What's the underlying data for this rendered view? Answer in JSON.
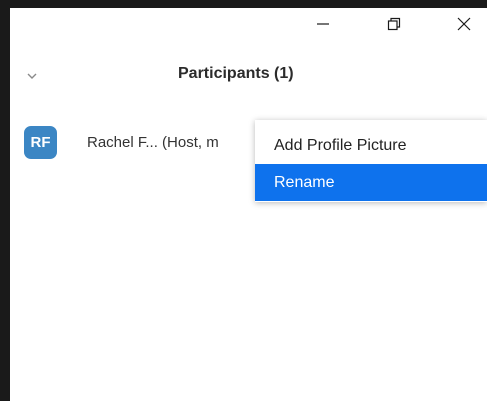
{
  "window_controls": {
    "minimize_icon": "minimize-icon",
    "restore_icon": "restore-icon",
    "close_icon": "close-icon"
  },
  "panel": {
    "title": "Participants (1)",
    "collapse_icon": "chevron-down-icon"
  },
  "participants": [
    {
      "initials": "RF",
      "name": "Rachel F... (Host, m",
      "avatar_color": "#3b86c4"
    }
  ],
  "context_menu": {
    "items": [
      {
        "label": "Add Profile Picture",
        "selected": false
      },
      {
        "label": "Rename",
        "selected": true
      }
    ],
    "highlight_color": "#0e72ed"
  }
}
